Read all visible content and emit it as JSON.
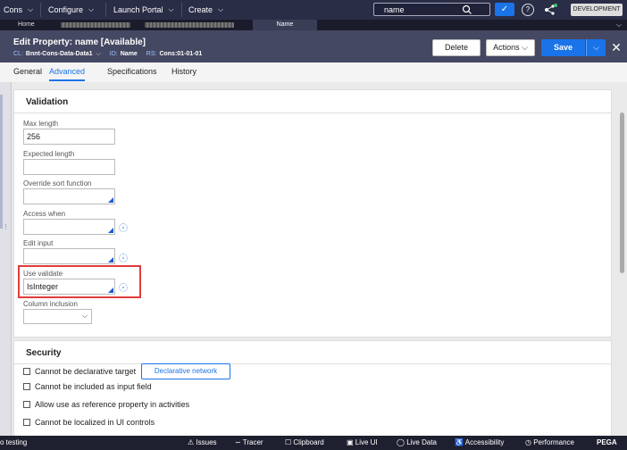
{
  "topnav": {
    "app_menu": "Cons",
    "configure": "Configure",
    "launch_portal": "Launch Portal",
    "create": "Create",
    "search_value": "name",
    "environment_badge": "DEVELOPMENT"
  },
  "tabstrip": {
    "home": "Home",
    "active_tab": "Name"
  },
  "header": {
    "title": "Edit  Property: name [Available]",
    "cl_label": "CL:",
    "cl_value": "Bnnt-Cons-Data-Data1",
    "id_label": "ID:",
    "id_value": "Name",
    "rs_label": "RS:",
    "rs_value": "Cons:01-01-01",
    "delete_label": "Delete",
    "actions_label": "Actions",
    "save_label": "Save"
  },
  "subtabs": [
    "General",
    "Advanced",
    "Specifications",
    "History"
  ],
  "validation": {
    "title": "Validation",
    "max_length_label": "Max length",
    "max_length_value": "256",
    "expected_length_label": "Expected length",
    "expected_length_value": "",
    "override_sort_label": "Override sort function",
    "access_when_label": "Access when",
    "edit_input_label": "Edit input",
    "use_validate_label": "Use validate",
    "use_validate_value": "IsInteger",
    "column_inclusion_label": "Column inclusion"
  },
  "security": {
    "title": "Security",
    "items": [
      "Cannot be declarative target",
      "Cannot be included as input field",
      "Allow use as reference property in activities",
      "Cannot be localized in UI controls"
    ],
    "declarative_network_label": "Declarative network"
  },
  "statusbar": {
    "left_text": "o testing",
    "items": [
      "Issues",
      "Tracer",
      "Clipboard",
      "Live UI",
      "Live Data",
      "Accessibility",
      "Performance"
    ],
    "brand": "PEGA"
  },
  "colors": {
    "nav_bg": "#2a2d46",
    "header_bg": "#454862",
    "accent": "#1a73e8",
    "highlight": "#e23c3c"
  }
}
